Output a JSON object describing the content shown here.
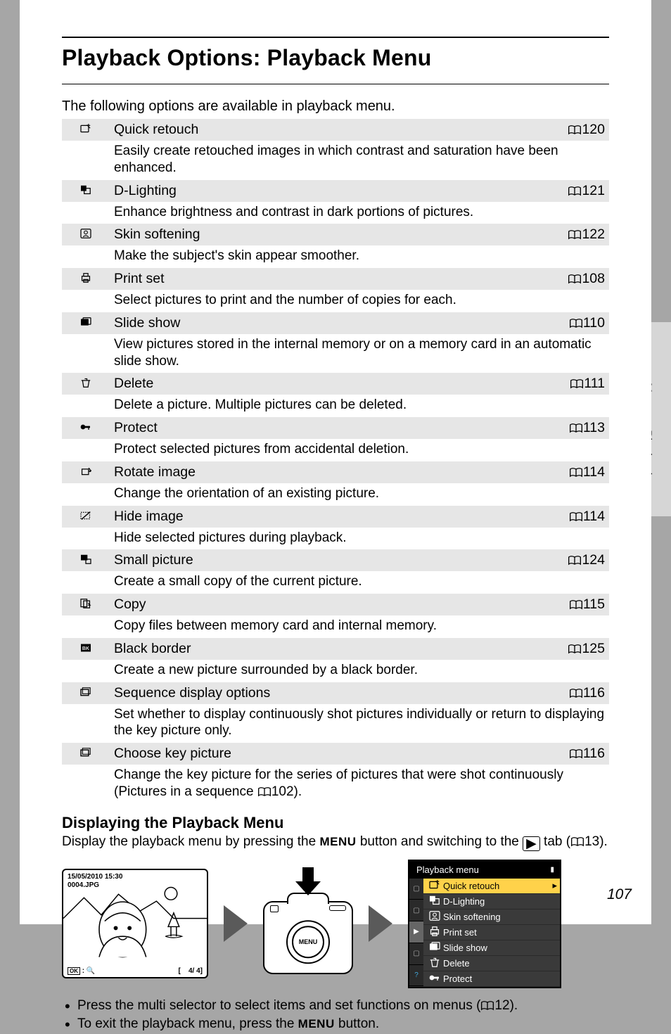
{
  "title": "Playback Options: Playback Menu",
  "intro": "The following options are available in playback menu.",
  "side_tab": "More on Playback",
  "page_number": "107",
  "items": [
    {
      "icon": "retouch",
      "name": "Quick retouch",
      "page": "120",
      "desc": "Easily create retouched images in which contrast and saturation have been enhanced."
    },
    {
      "icon": "dlighting",
      "name": "D-Lighting",
      "page": "121",
      "desc": "Enhance brightness and contrast in dark portions of pictures."
    },
    {
      "icon": "skin",
      "name": "Skin softening",
      "page": "122",
      "desc": "Make the subject's skin appear smoother."
    },
    {
      "icon": "printset",
      "name": "Print set",
      "page": "108",
      "desc": "Select pictures to print and the number of copies for each."
    },
    {
      "icon": "slideshow",
      "name": "Slide show",
      "page": "110",
      "desc": "View pictures stored in the internal memory or on a memory card in an automatic slide show."
    },
    {
      "icon": "delete",
      "name": "Delete",
      "page": "111",
      "desc": "Delete a picture. Multiple pictures can be deleted."
    },
    {
      "icon": "protect",
      "name": "Protect",
      "page": "113",
      "desc": "Protect selected pictures from accidental deletion."
    },
    {
      "icon": "rotate",
      "name": "Rotate image",
      "page": "114",
      "desc": "Change the orientation of an existing picture."
    },
    {
      "icon": "hide",
      "name": "Hide image",
      "page": "114",
      "desc": "Hide selected pictures during playback."
    },
    {
      "icon": "small",
      "name": "Small picture",
      "page": "124",
      "desc": "Create a small copy of the current picture."
    },
    {
      "icon": "copy",
      "name": "Copy",
      "page": "115",
      "desc": "Copy files between memory card and internal memory."
    },
    {
      "icon": "border",
      "name": "Black border",
      "page": "125",
      "desc": "Create a new picture surrounded by a black border."
    },
    {
      "icon": "sequence",
      "name": "Sequence display options",
      "page": "116",
      "desc": "Set whether to display continuously shot pictures individually or return to displaying the key picture only."
    },
    {
      "icon": "keypic",
      "name": "Choose key picture",
      "page": "116",
      "desc": "Change the key picture for the series of pictures that were shot continuously (Pictures in a sequence ",
      "desc_ref": "102",
      "desc_tail": ")."
    }
  ],
  "subhead": "Displaying the Playback Menu",
  "display_line": {
    "pre": "Display the playback menu by pressing the ",
    "menu": "MENU",
    "mid": " button and switching to the ",
    "post": " tab (",
    "ref": "13",
    "tail": ")."
  },
  "lcd": {
    "date": "15/05/2010 15:30",
    "file": "0004.JPG",
    "ok_label": "OK :",
    "counter": "4/    4"
  },
  "camera_menu_label": "MENU",
  "onscreen_menu": {
    "title": "Playback menu",
    "items": [
      {
        "icon": "retouch",
        "label": "Quick retouch",
        "selected": true
      },
      {
        "icon": "dlighting",
        "label": "D-Lighting",
        "selected": false
      },
      {
        "icon": "skin",
        "label": "Skin softening",
        "selected": false
      },
      {
        "icon": "printset",
        "label": "Print set",
        "selected": false
      },
      {
        "icon": "slideshow",
        "label": "Slide show",
        "selected": false
      },
      {
        "icon": "delete",
        "label": "Delete",
        "selected": false
      },
      {
        "icon": "protect",
        "label": "Protect",
        "selected": false
      }
    ]
  },
  "bullets": [
    {
      "pre": "Press the multi selector to select items and set functions on menus (",
      "ref": "12",
      "tail": ")."
    },
    {
      "pre": "To exit the playback menu, press the ",
      "menu": "MENU",
      "tail": " button."
    }
  ]
}
